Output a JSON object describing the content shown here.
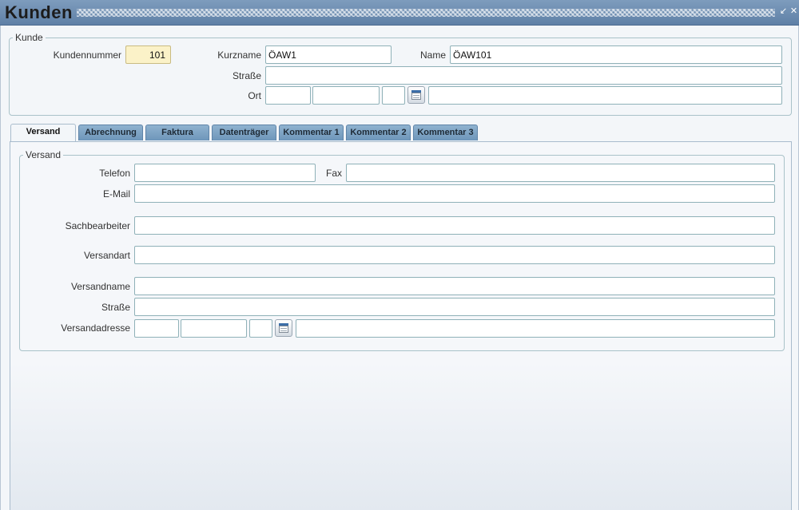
{
  "window": {
    "title": "Kunden",
    "buttons": [
      "minimize-icon",
      "close-icon"
    ]
  },
  "kunde": {
    "legend": "Kunde",
    "kundennummer_label": "Kundennummer",
    "kundennummer_value": "101",
    "kurzname_label": "Kurzname",
    "kurzname_value": "ÖAW1",
    "name_label": "Name",
    "name_value": "ÖAW101",
    "strasse_label": "Straße",
    "strasse_value": "",
    "ort_label": "Ort",
    "ort_values": [
      "",
      "",
      "",
      ""
    ]
  },
  "tabs": [
    {
      "label": "Versand",
      "active": true
    },
    {
      "label": "Abrechnung",
      "active": false
    },
    {
      "label": "Faktura",
      "active": false
    },
    {
      "label": "Datenträger",
      "active": false
    },
    {
      "label": "Kommentar 1",
      "active": false
    },
    {
      "label": "Kommentar 2",
      "active": false
    },
    {
      "label": "Kommentar 3",
      "active": false
    }
  ],
  "versand": {
    "legend": "Versand",
    "telefon_label": "Telefon",
    "telefon_value": "",
    "fax_label": "Fax",
    "fax_value": "",
    "email_label": "E-Mail",
    "email_value": "",
    "sachbearbeiter_label": "Sachbearbeiter",
    "sachbearbeiter_value": "",
    "versandart_label": "Versandart",
    "versandart_value": "",
    "versandname_label": "Versandname",
    "versandname_value": "",
    "strasse_label": "Straße",
    "strasse_value": "",
    "versandadresse_label": "Versandadresse",
    "versandadresse_values": [
      "",
      "",
      "",
      ""
    ]
  }
}
